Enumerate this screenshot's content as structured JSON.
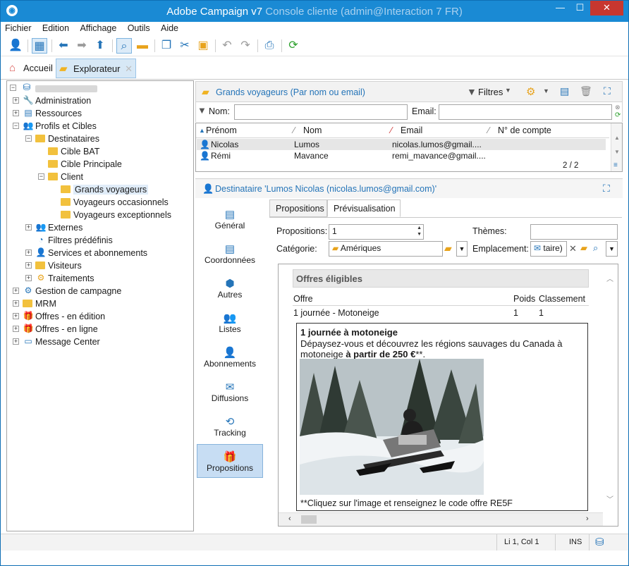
{
  "window": {
    "title": "Adobe Campaign v7",
    "subtitle": "Console cliente (admin@Interaction 7 FR)",
    "min": "—",
    "max": "☐",
    "close": "✕"
  },
  "menu": [
    "Fichier",
    "Edition",
    "Affichage",
    "Outils",
    "Aide"
  ],
  "tabs": {
    "home": "Accueil",
    "explorer": "Explorateur"
  },
  "tree": {
    "root": "",
    "items": [
      {
        "label": "Administration",
        "icon": "wrench-icon"
      },
      {
        "label": "Ressources",
        "icon": "resources-icon"
      },
      {
        "label": "Profils et Cibles",
        "icon": "people-icon"
      },
      {
        "label": "Destinataires",
        "icon": "folder-icon"
      },
      {
        "label": "Cible BAT",
        "icon": "folder-icon"
      },
      {
        "label": "Cible Principale",
        "icon": "folder-icon"
      },
      {
        "label": "Client",
        "icon": "folder-icon"
      },
      {
        "label": "Grands voyageurs",
        "icon": "folder-icon"
      },
      {
        "label": "Voyageurs occasionnels",
        "icon": "folder-icon"
      },
      {
        "label": "Voyageurs exceptionnels",
        "icon": "folder-icon"
      },
      {
        "label": "Externes",
        "icon": "people-icon"
      },
      {
        "label": "Filtres prédéfinis",
        "icon": "filter-icon"
      },
      {
        "label": "Services et abonnements",
        "icon": "person-icon"
      },
      {
        "label": "Visiteurs",
        "icon": "folder-icon"
      },
      {
        "label": "Traitements",
        "icon": "gears-icon"
      },
      {
        "label": "Gestion de campagne",
        "icon": "campaign-icon"
      },
      {
        "label": "MRM",
        "icon": "folder-icon"
      },
      {
        "label": "Offres - en édition",
        "icon": "gift-icon"
      },
      {
        "label": "Offres - en ligne",
        "icon": "gift-icon"
      },
      {
        "label": "Message Center",
        "icon": "screen-icon"
      }
    ]
  },
  "list": {
    "header": "Grands voyageurs (Par nom ou email)",
    "filters_label": "Filtres",
    "nom_label": "Nom:",
    "email_label": "Email:",
    "columns": [
      "Prénom",
      "Nom",
      "Email",
      "N° de compte"
    ],
    "rows": [
      [
        "Nicolas",
        "Lumos",
        "nicolas.lumos@gmail....",
        ""
      ],
      [
        "Rémi",
        "Mavance",
        "remi_mavance@gmail....",
        ""
      ]
    ],
    "count": "2 / 2"
  },
  "detail": {
    "header": "Destinataire 'Lumos Nicolas (nicolas.lumos@gmail.com)'",
    "nav": [
      "Général",
      "Coordonnées",
      "Autres",
      "Listes",
      "Abonnements",
      "Diffusions",
      "Tracking",
      "Propositions"
    ],
    "tabs": [
      "Propositions",
      "Prévisualisation"
    ],
    "form": {
      "propositions_label": "Propositions:",
      "propositions_value": "1",
      "themes_label": "Thèmes:",
      "themes_value": "",
      "categorie_label": "Catégorie:",
      "categorie_value": "Amériques",
      "emplacement_label": "Emplacement:",
      "emplacement_value": "taire)"
    },
    "preview": {
      "section_title": "Offres éligibles",
      "col_offre": "Offre",
      "col_poids": "Poids",
      "col_classement": "Classement",
      "row_offre": "1 journée - Motoneige",
      "row_poids": "1",
      "row_classement": "1",
      "offer_title": "1 journée à motoneige",
      "offer_text": "Dépaysez-vous et découvrez les régions sauvages du Canada à motoneige ",
      "offer_price": "à partir de 250 €",
      "offer_tail": "**.",
      "footnote": "**Cliquez sur l'image et renseignez le code offre RE5F"
    }
  },
  "status": {
    "position": "Li 1, Col 1",
    "mode": "INS"
  },
  "colors": {
    "accent": "#1a8ad4",
    "link": "#2474b8",
    "folder": "#f2c13d"
  }
}
